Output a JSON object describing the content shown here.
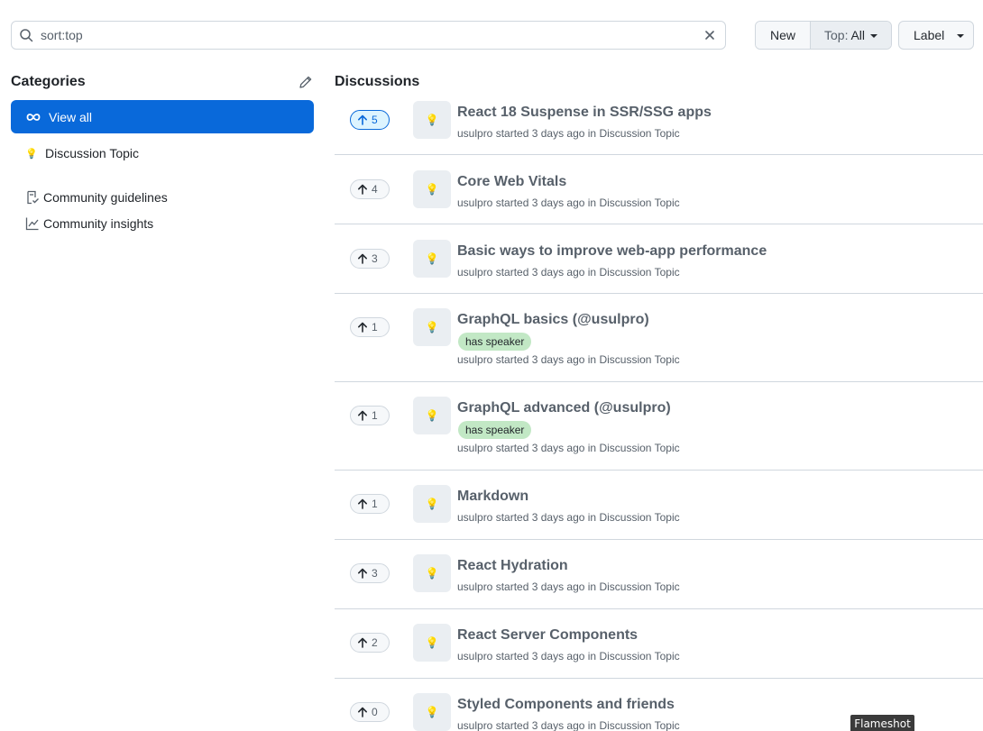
{
  "search": {
    "value": "sort:top",
    "placeholder": ""
  },
  "sort_buttons": {
    "new_label": "New",
    "top_prefix": "Top:",
    "top_value": "All"
  },
  "label_button": "Label",
  "sidebar": {
    "title": "Categories",
    "view_all": "View all",
    "categories": [
      {
        "emoji": "💡",
        "label": "Discussion Topic"
      }
    ],
    "links": [
      {
        "label": "Community guidelines",
        "icon": "checklist-icon"
      },
      {
        "label": "Community insights",
        "icon": "graph-icon"
      }
    ]
  },
  "discussions": {
    "title": "Discussions",
    "items": [
      {
        "votes": "5",
        "emoji": "💡",
        "title": "React 18 Suspense in SSR/SSG apps",
        "author": "usulpro",
        "started": "started 3 days ago in",
        "category": "Discussion Topic",
        "label": null,
        "active": true
      },
      {
        "votes": "4",
        "emoji": "💡",
        "title": "Core Web Vitals",
        "author": "usulpro",
        "started": "started 3 days ago in",
        "category": "Discussion Topic",
        "label": null
      },
      {
        "votes": "3",
        "emoji": "💡",
        "title": "Basic ways to improve web-app performance",
        "author": "usulpro",
        "started": "started 3 days ago in",
        "category": "Discussion Topic",
        "label": null
      },
      {
        "votes": "1",
        "emoji": "💡",
        "title": "GraphQL basics (@usulpro)",
        "author": "usulpro",
        "started": "started 3 days ago in",
        "category": "Discussion Topic",
        "label": "has speaker"
      },
      {
        "votes": "1",
        "emoji": "💡",
        "title": "GraphQL advanced (@usulpro)",
        "author": "usulpro",
        "started": "started 3 days ago in",
        "category": "Discussion Topic",
        "label": "has speaker"
      },
      {
        "votes": "1",
        "emoji": "💡",
        "title": "Markdown",
        "author": "usulpro",
        "started": "started 3 days ago in",
        "category": "Discussion Topic",
        "label": null
      },
      {
        "votes": "3",
        "emoji": "💡",
        "title": "React Hydration",
        "author": "usulpro",
        "started": "started 3 days ago in",
        "category": "Discussion Topic",
        "label": null
      },
      {
        "votes": "2",
        "emoji": "💡",
        "title": "React Server Components",
        "author": "usulpro",
        "started": "started 3 days ago in",
        "category": "Discussion Topic",
        "label": null
      },
      {
        "votes": "0",
        "emoji": "💡",
        "title": "Styled Components and friends",
        "author": "usulpro",
        "started": "started 3 days ago in",
        "category": "Discussion Topic",
        "label": null
      }
    ]
  },
  "overlay": {
    "flameshot": "Flameshot"
  }
}
